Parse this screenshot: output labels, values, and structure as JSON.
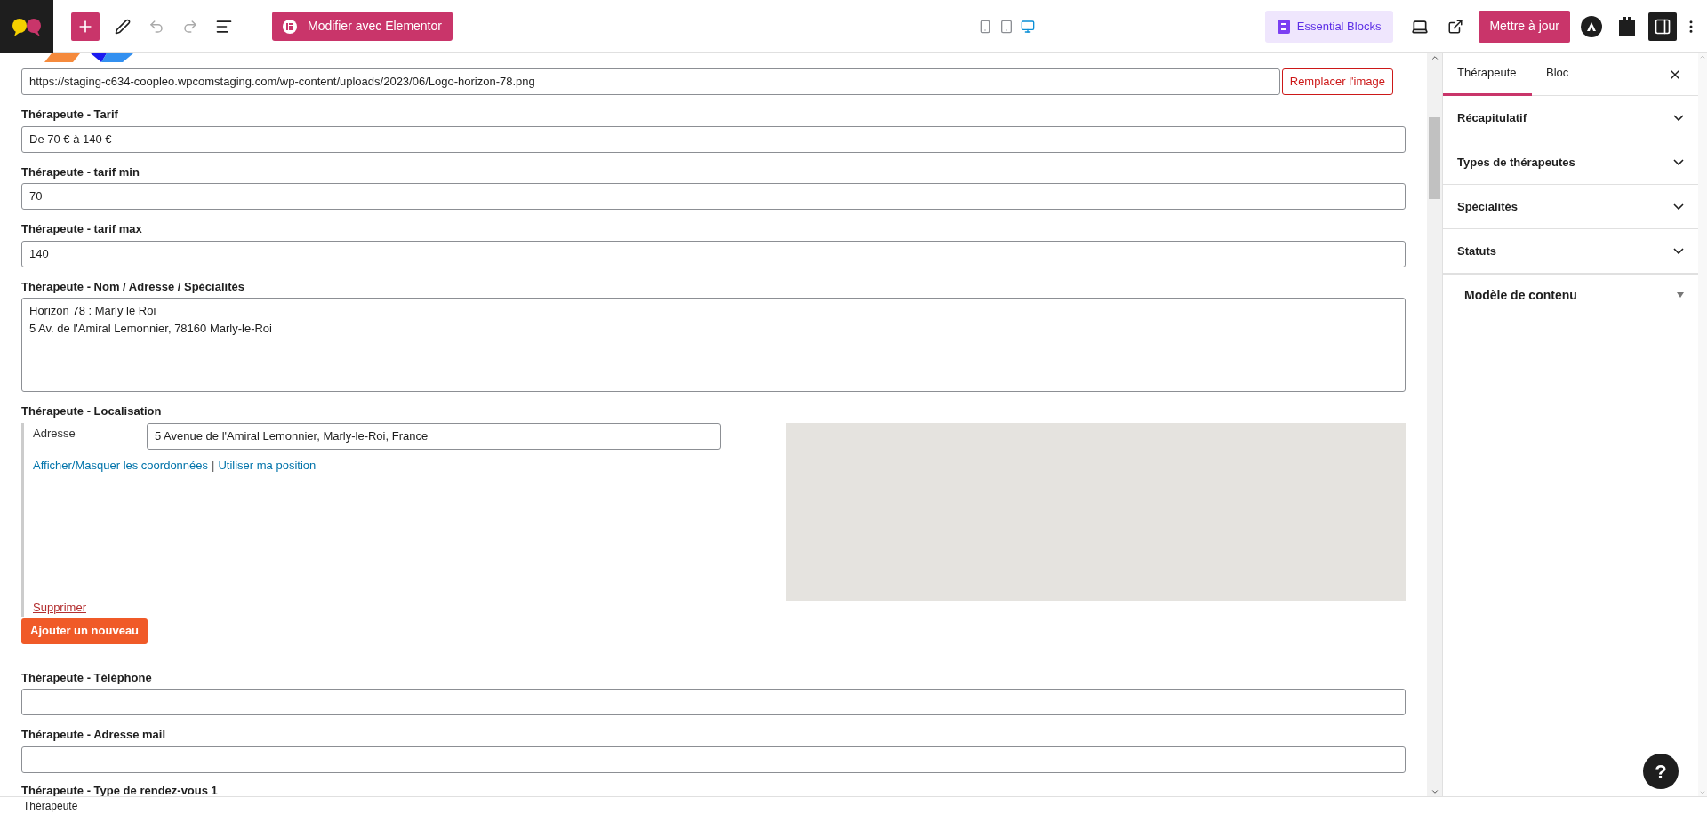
{
  "toolbar": {
    "elementor_button": "Modifier avec Elementor",
    "preview_devices": [
      {
        "kind": "mobile",
        "selected": false
      },
      {
        "kind": "tablet",
        "selected": false
      },
      {
        "kind": "desktop",
        "selected": true
      }
    ],
    "essential_blocks": "Essential Blocks",
    "update_button": "Mettre à jour",
    "sidebar_toggle": {
      "on": true
    }
  },
  "fields": [
    {
      "kind": "image_url",
      "value": "https://staging-c634-coopleo.wpcomstaging.com/wp-content/uploads/2023/06/Logo-horizon-78.png",
      "button": "Remplacer l'image"
    },
    {
      "kind": "text",
      "label": "Thérapeute - Tarif",
      "value": "De 70 € à 140 €"
    },
    {
      "kind": "text",
      "label": "Thérapeute - tarif min",
      "value": "70"
    },
    {
      "kind": "text",
      "label": "Thérapeute - tarif max",
      "value": "140"
    },
    {
      "kind": "textarea",
      "label": "Thérapeute - Nom / Adresse / Spécialités",
      "lines": [
        "Horizon 78 : Marly le Roi",
        "5 Av. de l'Amiral Lemonnier, 78160 Marly-le-Roi"
      ]
    },
    {
      "kind": "location",
      "label": "Thérapeute - Localisation",
      "address_label": "Adresse",
      "address": "5 Avenue de l'Amiral Lemonnier, Marly-le-Roi, France",
      "links": [
        "Afficher/Masquer les coordonnées",
        "Utiliser ma position"
      ],
      "link_separator": "|",
      "delete": "Supprimer",
      "add_button": "Ajouter un nouveau"
    },
    {
      "kind": "text",
      "label": "Thérapeute - Téléphone"
    },
    {
      "kind": "text",
      "label": "Thérapeute - Adresse mail"
    },
    {
      "kind": "heading",
      "label": "Thérapeute - Type de rendez-vous 1"
    }
  ],
  "sidebar": {
    "tabs": [
      {
        "label": "Thérapeute",
        "selected": true
      },
      {
        "label": "Bloc",
        "selected": false
      }
    ],
    "panels": [
      {
        "label": "Récapitulatif",
        "expanded": false
      },
      {
        "label": "Types de thérapeutes",
        "expanded": false
      },
      {
        "label": "Spécialités",
        "expanded": false
      },
      {
        "label": "Statuts",
        "expanded": false
      }
    ],
    "model_panel": "Modèle de contenu"
  },
  "help_button": "?",
  "breadcrumb": "Thérapeute"
}
